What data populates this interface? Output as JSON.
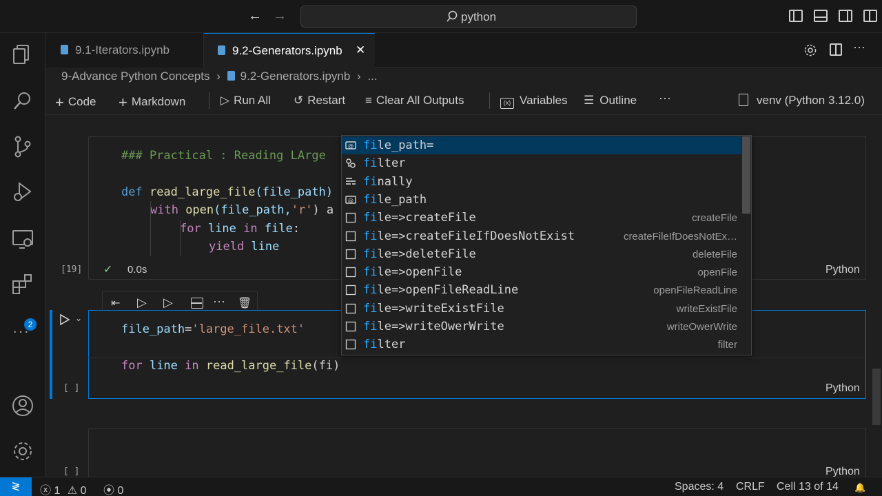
{
  "titlebar": {
    "search_text": "python"
  },
  "activity": {
    "extensions_badge": "2"
  },
  "tabs": [
    {
      "label": "9.1-Iterators.ipynb"
    },
    {
      "label": "9.2-Generators.ipynb",
      "close": "✕"
    }
  ],
  "breadcrumb": {
    "folder": "9-Advance Python Concepts",
    "file": "9.2-Generators.ipynb",
    "more": "..."
  },
  "toolbar": {
    "code": "Code",
    "markdown": "Markdown",
    "run_all": "Run All",
    "restart": "Restart",
    "clear_outputs": "Clear All Outputs",
    "variables": "Variables",
    "outline": "Outline",
    "more": "···",
    "kernel": "venv (Python 3.12.0)"
  },
  "cells": {
    "cell1": {
      "exec_count": "[19]",
      "status_check": "✓",
      "duration": "0.0s",
      "language": "Python",
      "line1": "### Practical : Reading LArge",
      "line2_def": "def ",
      "line2_fn": "read_large_file",
      "line2_rest": "(file_path)",
      "line3_with": "with ",
      "line3_fn": "open",
      "line3_args": "(file_path,",
      "line3_str": "'r'",
      "line3_rest": ") a",
      "line4_for": "for ",
      "line4_var": "line ",
      "line4_in": "in ",
      "line4_var2": "file",
      "line4_rest": ":",
      "line5_yield": "yield ",
      "line5_var": "line"
    },
    "cell2": {
      "exec_count": "[ ]",
      "language": "Python",
      "line1_var": "file_path",
      "line1_eq": "=",
      "line1_str": "'large_file.txt'",
      "line2_for": "for ",
      "line2_var": "line ",
      "line2_in": "in ",
      "line2_fn": "read_large_file",
      "line2_args": "(fi)"
    },
    "cell3": {
      "exec_count": "[ ]",
      "language": "Python"
    }
  },
  "suggest": [
    {
      "match": "fi",
      "rest": "le_path=",
      "detail": "",
      "icon": "variable-icon"
    },
    {
      "match": "fi",
      "rest": "lter",
      "detail": "",
      "icon": "class-icon"
    },
    {
      "match": "fi",
      "rest": "nally",
      "detail": "",
      "icon": "keyword-icon"
    },
    {
      "match": "fi",
      "rest": "le_path",
      "detail": "",
      "icon": "variable-icon"
    },
    {
      "match": "fi",
      "rest": "le=>createFile",
      "detail": "createFile",
      "icon": "snippet-icon"
    },
    {
      "match": "fi",
      "rest": "le=>createFileIfDoesNotExist",
      "detail": "createFileIfDoesNotEx…",
      "icon": "snippet-icon"
    },
    {
      "match": "fi",
      "rest": "le=>deleteFile",
      "detail": "deleteFile",
      "icon": "snippet-icon"
    },
    {
      "match": "fi",
      "rest": "le=>openFile",
      "detail": "openFile",
      "icon": "snippet-icon"
    },
    {
      "match": "fi",
      "rest": "le=>openFileReadLine",
      "detail": "openFileReadLine",
      "icon": "snippet-icon"
    },
    {
      "match": "fi",
      "rest": "le=>writeExistFile",
      "detail": "writeExistFile",
      "icon": "snippet-icon"
    },
    {
      "match": "fi",
      "rest": "le=>writeOwerWrite",
      "detail": "writeOwerWrite",
      "icon": "snippet-icon"
    },
    {
      "match": "fi",
      "rest": "lter",
      "detail": "filter",
      "icon": "snippet-icon"
    }
  ],
  "status": {
    "errors": "1",
    "warnings": "0",
    "ports": "0",
    "spaces": "Spaces: 4",
    "eol": "CRLF",
    "cell": "Cell 13 of 14"
  },
  "colors": {
    "accent": "#0078d4",
    "selection": "#04395e",
    "match": "#2aaaff"
  }
}
